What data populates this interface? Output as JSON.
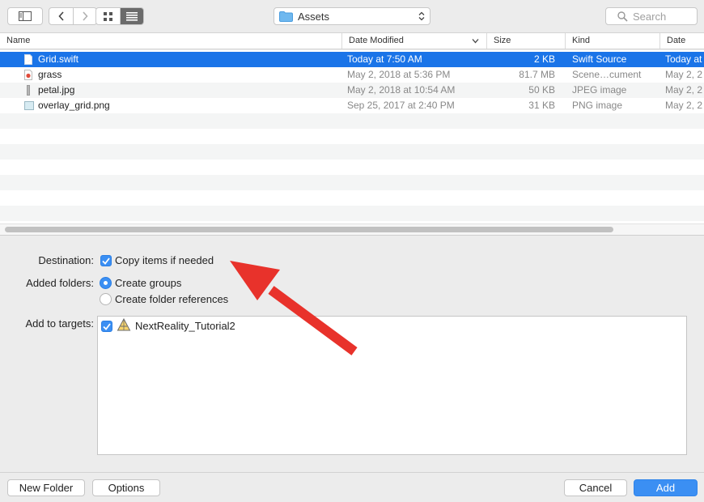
{
  "toolbar": {
    "location": "Assets",
    "search_placeholder": "Search"
  },
  "columns": {
    "name": "Name",
    "date_modified": "Date Modified",
    "size": "Size",
    "kind": "Kind",
    "date_added": "Date Adde"
  },
  "files": [
    {
      "name": "Grid.swift",
      "date": "Today at 7:50 AM",
      "size": "2 KB",
      "kind": "Swift Source",
      "added": "Today at"
    },
    {
      "name": "grass",
      "date": "May 2, 2018 at 5:36 PM",
      "size": "81.7 MB",
      "kind": "Scene…cument",
      "added": "May 2, 2"
    },
    {
      "name": "petal.jpg",
      "date": "May 2, 2018 at 10:54 AM",
      "size": "50 KB",
      "kind": "JPEG image",
      "added": "May 2, 2"
    },
    {
      "name": "overlay_grid.png",
      "date": "Sep 25, 2017 at 2:40 PM",
      "size": "31 KB",
      "kind": "PNG image",
      "added": "May 2, 2"
    }
  ],
  "options": {
    "destination_label": "Destination:",
    "copy_items": "Copy items if needed",
    "added_folders_label": "Added folders:",
    "create_groups": "Create groups",
    "create_folder_refs": "Create folder references",
    "targets_label": "Add to targets:",
    "target_name": "NextReality_Tutorial2"
  },
  "buttons": {
    "new_folder": "New Folder",
    "options": "Options",
    "cancel": "Cancel",
    "add": "Add"
  },
  "colors": {
    "selection": "#1a74e8",
    "accent": "#3b8ff3",
    "annotation_arrow": "#e8322b"
  }
}
